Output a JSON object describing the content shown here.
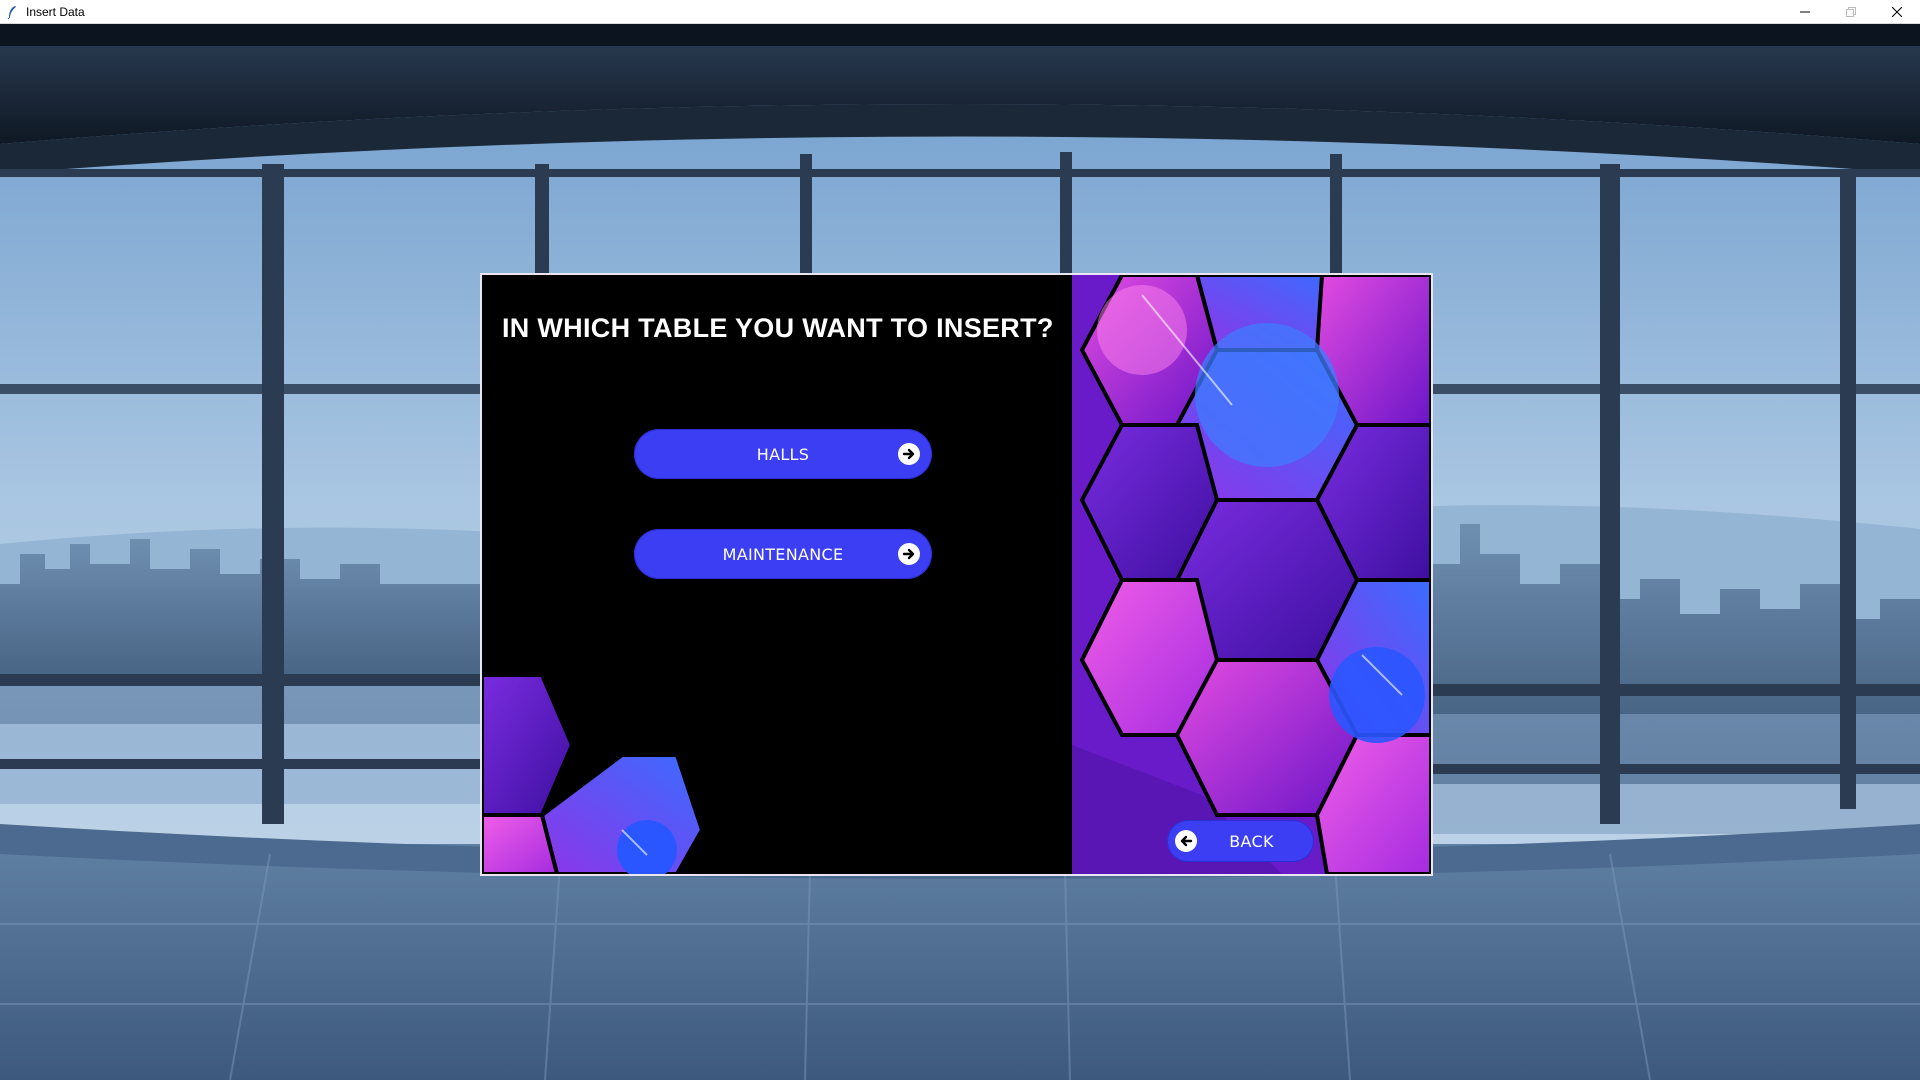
{
  "window": {
    "title": "Insert Data",
    "icon": "feather-icon",
    "controls": [
      "minimize-icon",
      "maximize-icon",
      "close-icon"
    ]
  },
  "dialog": {
    "heading": "IN WHICH TABLE YOU WANT TO INSERT?",
    "options": [
      {
        "label": "HALLS",
        "icon": "arrow-right-circle-icon"
      },
      {
        "label": "MAINTENANCE",
        "icon": "arrow-right-circle-icon"
      }
    ],
    "back": {
      "label": "BACK",
      "icon": "arrow-left-circle-icon"
    }
  },
  "colors": {
    "button": "#3b3ef2",
    "panel": "#000000",
    "accent_purple": "#8a1fd6",
    "accent_magenta": "#e03bd8",
    "accent_blue": "#2a56ff"
  }
}
